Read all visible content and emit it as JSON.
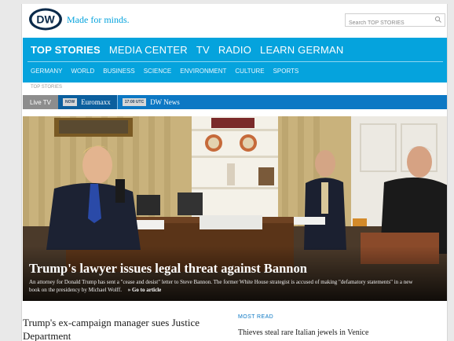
{
  "brand": {
    "logo_text": "DW",
    "tagline": "Made for minds.",
    "color": "#05a3dd"
  },
  "search": {
    "placeholder": "Search TOP STORIES",
    "icon": "search-icon"
  },
  "nav": {
    "main": [
      {
        "label": "TOP STORIES",
        "active": true
      },
      {
        "label": "MEDIA CENTER",
        "active": false
      },
      {
        "label": "TV",
        "active": false
      },
      {
        "label": "RADIO",
        "active": false
      },
      {
        "label": "LEARN GERMAN",
        "active": false
      }
    ],
    "sub": [
      "GERMANY",
      "WORLD",
      "BUSINESS",
      "SCIENCE",
      "ENVIRONMENT",
      "CULTURE",
      "SPORTS"
    ]
  },
  "breadcrumb": "TOP STORIES",
  "livebar": {
    "live_tv": "Live TV",
    "channels": [
      {
        "badge": "NOW",
        "name": "Euromaxx"
      },
      {
        "badge": "17:00 UTC",
        "name": "DW News"
      }
    ]
  },
  "hero": {
    "title": "Trump's lawyer issues legal threat against Bannon",
    "teaser": "An attorney for Donald Trump has sent a \"cease and desist\" letter to Steve Bannon. The former White House strategist is accused of making \"defamatory statements\" in a new book on the presidency by Michael Wolff.",
    "goto": "» Go to article"
  },
  "below": {
    "headline_1": "Trump's ex-campaign manager sues Justice",
    "headline_2": "Department",
    "most_read_label": "MOST READ",
    "most_read_item": "Thieves steal rare Italian jewels in Venice"
  }
}
